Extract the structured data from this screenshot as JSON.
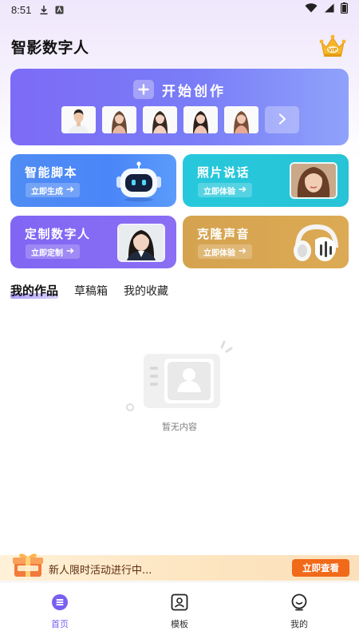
{
  "status_bar": {
    "time": "8:51"
  },
  "header": {
    "title": "智影数字人",
    "vip_icon": "vip-crown-icon"
  },
  "create": {
    "label": "开始创作",
    "avatars": [
      "avatar-man-white-shirt",
      "avatar-woman-1",
      "avatar-woman-2",
      "avatar-woman-3",
      "avatar-woman-4"
    ]
  },
  "features": [
    {
      "title": "智能脚本",
      "button": "立即生成",
      "color": "#4f8cf3"
    },
    {
      "title": "照片说话",
      "button": "立即体验",
      "color": "#27c8dc"
    },
    {
      "title": "定制数字人",
      "button": "立即定制",
      "color": "#8066f3"
    },
    {
      "title": "克隆声音",
      "button": "立即体验",
      "color": "#d5a350"
    }
  ],
  "tabs": [
    {
      "label": "我的作品",
      "active": true
    },
    {
      "label": "草稿箱",
      "active": false
    },
    {
      "label": "我的收藏",
      "active": false
    }
  ],
  "empty": {
    "text": "暂无内容"
  },
  "promo": {
    "text": "新人限时活动进行中...",
    "button": "立即查看"
  },
  "nav": [
    {
      "label": "首页",
      "active": true,
      "icon": "home-icon"
    },
    {
      "label": "模板",
      "active": false,
      "icon": "template-icon"
    },
    {
      "label": "我的",
      "active": false,
      "icon": "profile-icon"
    }
  ],
  "colors": {
    "accent": "#7a5ef0",
    "promo_button": "#f06a19"
  }
}
